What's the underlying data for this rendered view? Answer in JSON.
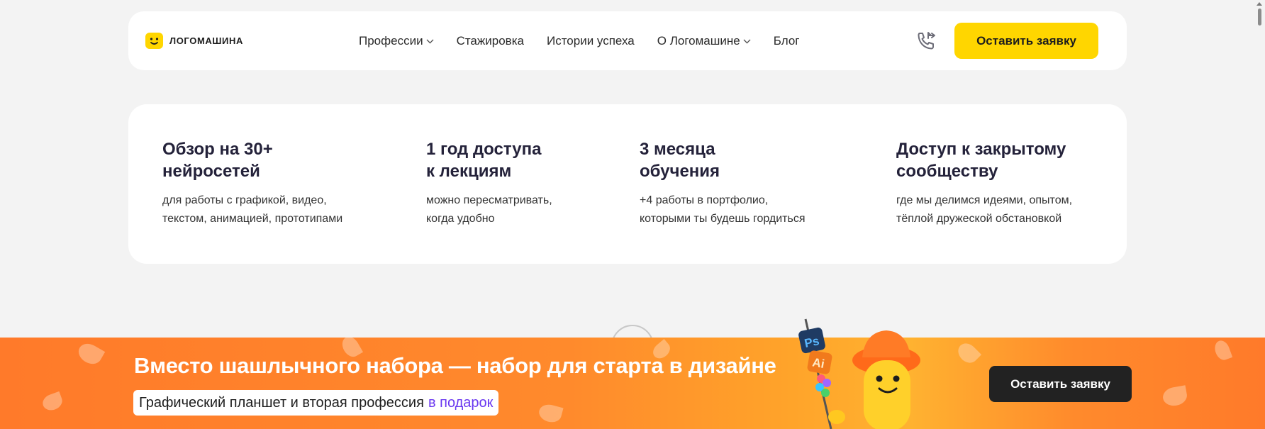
{
  "header": {
    "logo_text": "ЛОГОМАШИНА",
    "nav": [
      {
        "label": "Профессии",
        "has_dropdown": true
      },
      {
        "label": "Стажировка",
        "has_dropdown": false
      },
      {
        "label": "Истории успеха",
        "has_dropdown": false
      },
      {
        "label": "О Логомашине",
        "has_dropdown": true
      },
      {
        "label": "Блог",
        "has_dropdown": false
      }
    ],
    "phone_icon": "phone-callback-icon",
    "cta_label": "Оставить заявку"
  },
  "features": [
    {
      "title": "Обзор на 30+\nнейросетей",
      "desc": "для работы с графикой, видео,\nтекстом, анимацией, прототипами"
    },
    {
      "title": "1 год доступа\nк лекциям",
      "desc": "можно пересматривать,\nкогда удобно"
    },
    {
      "title": "3 месяца\nобучения",
      "desc": "+4 работы в портфолио,\nкоторыми ты будешь гордиться"
    },
    {
      "title": "Доступ к закрытому\nсообществу",
      "desc": "где мы делимся идеями, опытом,\nтёплой дружеской обстановкой"
    }
  ],
  "banner": {
    "title": "Вместо шашлычного набора — набор для старта в дизайне",
    "subtitle": "Графический планшет и вторая профессия",
    "subtitle_highlight": "в подарок",
    "cta_label": "Оставить заявку",
    "skewer_labels": [
      "Ps",
      "Ai"
    ]
  },
  "colors": {
    "accent_yellow": "#ffd600",
    "banner_orange": "#ff7a2a",
    "highlight_purple": "#6a38f0",
    "dark_button": "#222222"
  }
}
